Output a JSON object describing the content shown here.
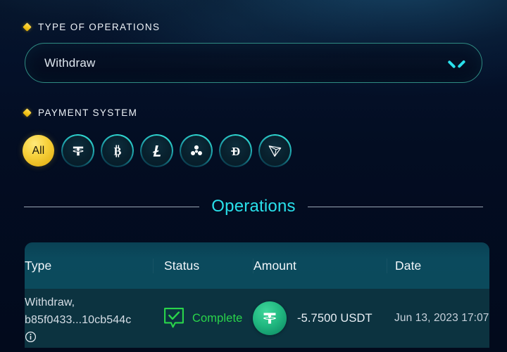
{
  "theme": {
    "accent_cyan": "#29e0ea",
    "accent_yellow": "#f5c518",
    "border_teal": "#2f8b82",
    "table_header_bg": "#0b4a5c",
    "table_row_bg": "#0c3340",
    "status_green": "#2ad54a",
    "page_bg": "#030b1c"
  },
  "type_of_operations": {
    "label": "TYPE OF OPERATIONS",
    "bullet_icon": "diamond-icon",
    "select": {
      "value": "Withdraw",
      "placeholder": "Withdraw",
      "chevron_icon": "chevron-down-icon"
    }
  },
  "payment_system": {
    "label": "PAYMENT SYSTEM",
    "bullet_icon": "diamond-icon",
    "options": [
      {
        "id": "all",
        "label": "All",
        "icon": "all-filter-icon",
        "selected": true
      },
      {
        "id": "usdt",
        "label": "Tether",
        "icon": "tether-icon",
        "selected": false
      },
      {
        "id": "btc",
        "label": "Bitcoin",
        "icon": "bitcoin-icon",
        "selected": false
      },
      {
        "id": "ltc",
        "label": "Litecoin",
        "icon": "litecoin-icon",
        "selected": false
      },
      {
        "id": "xrp",
        "label": "Ripple",
        "icon": "ripple-icon",
        "selected": false
      },
      {
        "id": "doge",
        "label": "Dogecoin",
        "icon": "dogecoin-icon",
        "selected": false
      },
      {
        "id": "trx",
        "label": "Tron",
        "icon": "tron-icon",
        "selected": false
      }
    ]
  },
  "operations": {
    "title": "Operations",
    "columns": [
      "Type",
      "Status",
      "Amount",
      "Date"
    ],
    "rows": [
      {
        "type_line1": "Withdraw,",
        "type_line2": "b85f0433...10cb544c",
        "info_icon": "info-icon",
        "status": "Complete",
        "status_icon": "check-bubble-icon",
        "amount": "-5.7500 USDT",
        "amount_icon": "tether-icon",
        "date": "Jun 13, 2023 17:07"
      }
    ]
  }
}
